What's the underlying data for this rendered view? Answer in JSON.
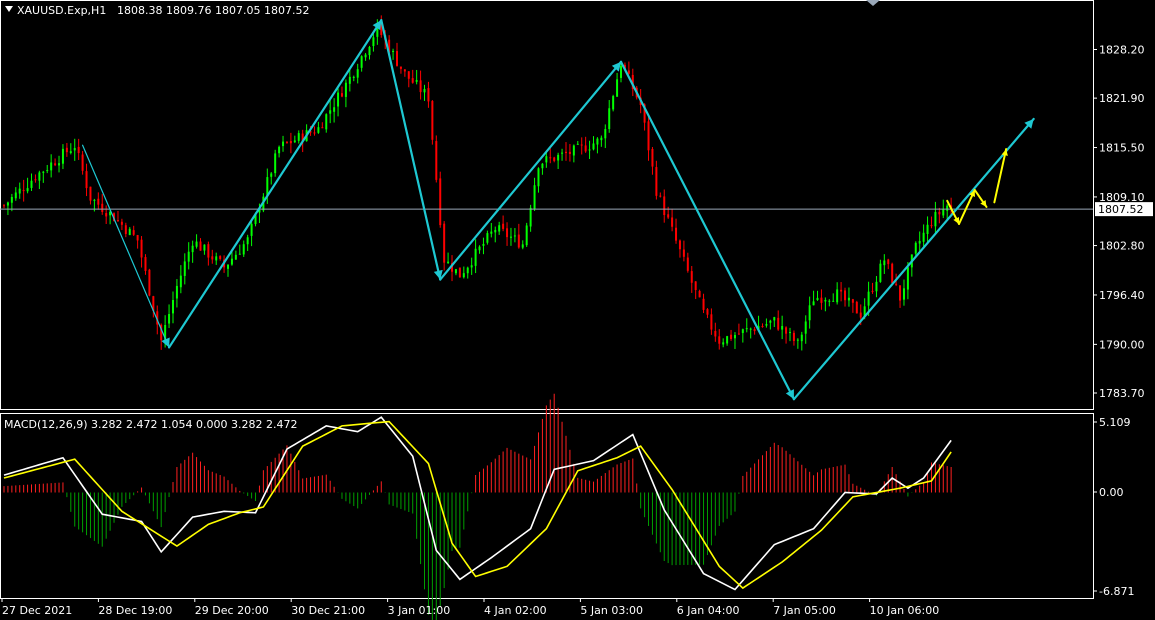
{
  "header": {
    "symbol": "XAUUSD.Exp,H1",
    "ohlc": "1808.38 1809.76 1807.05 1807.52"
  },
  "macd_header": "MACD(12,26,9) 3.282 2.472 1.054 0.000 3.282 2.472",
  "colors": {
    "background": "#000000",
    "bull": "#00ff00",
    "bear": "#ff0000",
    "wave": "#1ec8d2",
    "arrow_yellow": "#ffff00",
    "macd_main": "#ffffff",
    "macd_signal": "#ffff00",
    "hist_pos": "#ff2020",
    "hist_neg": "#00a000",
    "current_line": "#9aa8b8"
  },
  "chart_data": [
    {
      "type": "candlestick",
      "panel": "price",
      "y_ticks": [
        "1828.20",
        "1821.90",
        "1815.50",
        "1809.10",
        "1802.80",
        "1796.40",
        "1790.00",
        "1783.70"
      ],
      "current_price": "1807.52",
      "x_ticks": [
        "27 Dec 2021",
        "28 Dec 19:00",
        "29 Dec 20:00",
        "30 Dec 21:00",
        "3 Jan 01:00",
        "4 Jan 02:00",
        "5 Jan 03:00",
        "6 Jan 04:00",
        "7 Jan 05:00",
        "10 Jan 06:00"
      ],
      "close_path": [
        {
          "i": 0,
          "v": 1808.0
        },
        {
          "i": 8,
          "v": 1811.8
        },
        {
          "i": 18,
          "v": 1815.8
        },
        {
          "i": 22,
          "v": 1809.0
        },
        {
          "i": 28,
          "v": 1806.5
        },
        {
          "i": 34,
          "v": 1803.5
        },
        {
          "i": 40,
          "v": 1790.5
        },
        {
          "i": 44,
          "v": 1797.5
        },
        {
          "i": 48,
          "v": 1803.5
        },
        {
          "i": 56,
          "v": 1800.0
        },
        {
          "i": 62,
          "v": 1803.5
        },
        {
          "i": 70,
          "v": 1815.5
        },
        {
          "i": 80,
          "v": 1818.0
        },
        {
          "i": 88,
          "v": 1824.5
        },
        {
          "i": 95,
          "v": 1831.0
        },
        {
          "i": 102,
          "v": 1825.0
        },
        {
          "i": 108,
          "v": 1822.0
        },
        {
          "i": 112,
          "v": 1801.0
        },
        {
          "i": 116,
          "v": 1799.0
        },
        {
          "i": 125,
          "v": 1805.0
        },
        {
          "i": 132,
          "v": 1803.0
        },
        {
          "i": 136,
          "v": 1813.5
        },
        {
          "i": 145,
          "v": 1815.0
        },
        {
          "i": 152,
          "v": 1816.5
        },
        {
          "i": 157,
          "v": 1826.5
        },
        {
          "i": 162,
          "v": 1821.0
        },
        {
          "i": 166,
          "v": 1810.0
        },
        {
          "i": 172,
          "v": 1802.0
        },
        {
          "i": 178,
          "v": 1794.0
        },
        {
          "i": 182,
          "v": 1790.5
        },
        {
          "i": 190,
          "v": 1792.0
        },
        {
          "i": 196,
          "v": 1793.0
        },
        {
          "i": 202,
          "v": 1790.0
        },
        {
          "i": 206,
          "v": 1796.0
        },
        {
          "i": 212,
          "v": 1796.5
        },
        {
          "i": 218,
          "v": 1794.0
        },
        {
          "i": 224,
          "v": 1801.0
        },
        {
          "i": 228,
          "v": 1796.0
        },
        {
          "i": 232,
          "v": 1802.5
        },
        {
          "i": 236,
          "v": 1806.0
        },
        {
          "i": 240,
          "v": 1808.0
        },
        {
          "i": 241,
          "v": 1807.52
        }
      ],
      "wave_lines": [
        {
          "from": {
            "i": 20,
            "v": 1815.8
          },
          "to": {
            "i": 42,
            "v": 1789.6
          }
        },
        {
          "from": {
            "i": 42,
            "v": 1789.6
          },
          "to": {
            "i": 96,
            "v": 1832.0
          }
        },
        {
          "from": {
            "i": 96,
            "v": 1832.0
          },
          "to": {
            "i": 111,
            "v": 1798.4
          }
        },
        {
          "from": {
            "i": 111,
            "v": 1798.4
          },
          "to": {
            "i": 157,
            "v": 1826.6
          }
        },
        {
          "from": {
            "i": 157,
            "v": 1826.6
          },
          "to": {
            "i": 201,
            "v": 1782.9
          }
        },
        {
          "from": {
            "i": 201,
            "v": 1782.9
          },
          "to": {
            "i": 262,
            "v": 1819.2
          }
        }
      ],
      "yellow_arrows": [
        {
          "from": {
            "i": 240,
            "v": 1808.6
          },
          "to": {
            "i": 243,
            "v": 1805.6
          }
        },
        {
          "from": {
            "i": 243,
            "v": 1805.6
          },
          "to": {
            "i": 247,
            "v": 1810.0
          }
        },
        {
          "from": {
            "i": 247,
            "v": 1810.0
          },
          "to": {
            "i": 250,
            "v": 1807.8
          }
        },
        {
          "from": {
            "i": 252,
            "v": 1808.4
          },
          "to": {
            "i": 255,
            "v": 1815.3
          }
        }
      ]
    },
    {
      "type": "line",
      "panel": "macd",
      "title": "MACD(12,26,9) 3.282 2.472 1.054 0.000 3.282 2.472",
      "y_ticks": [
        "5.109",
        "0.00",
        "-6.871"
      ],
      "series": [
        {
          "name": "MACD",
          "points": [
            {
              "i": 0,
              "v": 1.2
            },
            {
              "i": 15,
              "v": 2.4
            },
            {
              "i": 25,
              "v": -1.5
            },
            {
              "i": 35,
              "v": -2.0
            },
            {
              "i": 40,
              "v": -4.1
            },
            {
              "i": 48,
              "v": -1.7
            },
            {
              "i": 56,
              "v": -1.3
            },
            {
              "i": 64,
              "v": -1.4
            },
            {
              "i": 72,
              "v": 3.0
            },
            {
              "i": 82,
              "v": 4.6
            },
            {
              "i": 90,
              "v": 4.2
            },
            {
              "i": 96,
              "v": 5.2
            },
            {
              "i": 104,
              "v": 2.5
            },
            {
              "i": 110,
              "v": -4.0
            },
            {
              "i": 116,
              "v": -6.0
            },
            {
              "i": 124,
              "v": -4.5
            },
            {
              "i": 134,
              "v": -2.5
            },
            {
              "i": 140,
              "v": 1.6
            },
            {
              "i": 150,
              "v": 2.2
            },
            {
              "i": 160,
              "v": 4.0
            },
            {
              "i": 168,
              "v": -1.2
            },
            {
              "i": 178,
              "v": -5.6
            },
            {
              "i": 186,
              "v": -6.7
            },
            {
              "i": 196,
              "v": -3.6
            },
            {
              "i": 206,
              "v": -2.5
            },
            {
              "i": 214,
              "v": 0.0
            },
            {
              "i": 222,
              "v": -0.1
            },
            {
              "i": 226,
              "v": 1.0
            },
            {
              "i": 230,
              "v": 0.3
            },
            {
              "i": 234,
              "v": 1.0
            },
            {
              "i": 241,
              "v": 3.6
            }
          ]
        },
        {
          "name": "Signal",
          "points": [
            {
              "i": 0,
              "v": 1.0
            },
            {
              "i": 18,
              "v": 2.3
            },
            {
              "i": 30,
              "v": -1.3
            },
            {
              "i": 44,
              "v": -3.7
            },
            {
              "i": 52,
              "v": -2.2
            },
            {
              "i": 60,
              "v": -1.4
            },
            {
              "i": 66,
              "v": -1.0
            },
            {
              "i": 76,
              "v": 3.2
            },
            {
              "i": 86,
              "v": 4.6
            },
            {
              "i": 98,
              "v": 4.9
            },
            {
              "i": 108,
              "v": 2.0
            },
            {
              "i": 114,
              "v": -3.5
            },
            {
              "i": 120,
              "v": -5.8
            },
            {
              "i": 128,
              "v": -5.1
            },
            {
              "i": 138,
              "v": -2.5
            },
            {
              "i": 146,
              "v": 1.5
            },
            {
              "i": 156,
              "v": 2.4
            },
            {
              "i": 162,
              "v": 3.2
            },
            {
              "i": 170,
              "v": 0.2
            },
            {
              "i": 182,
              "v": -5.1
            },
            {
              "i": 188,
              "v": -6.6
            },
            {
              "i": 198,
              "v": -4.8
            },
            {
              "i": 208,
              "v": -2.6
            },
            {
              "i": 216,
              "v": -0.3
            },
            {
              "i": 228,
              "v": 0.3
            },
            {
              "i": 236,
              "v": 0.8
            },
            {
              "i": 241,
              "v": 2.8
            }
          ]
        }
      ]
    }
  ]
}
